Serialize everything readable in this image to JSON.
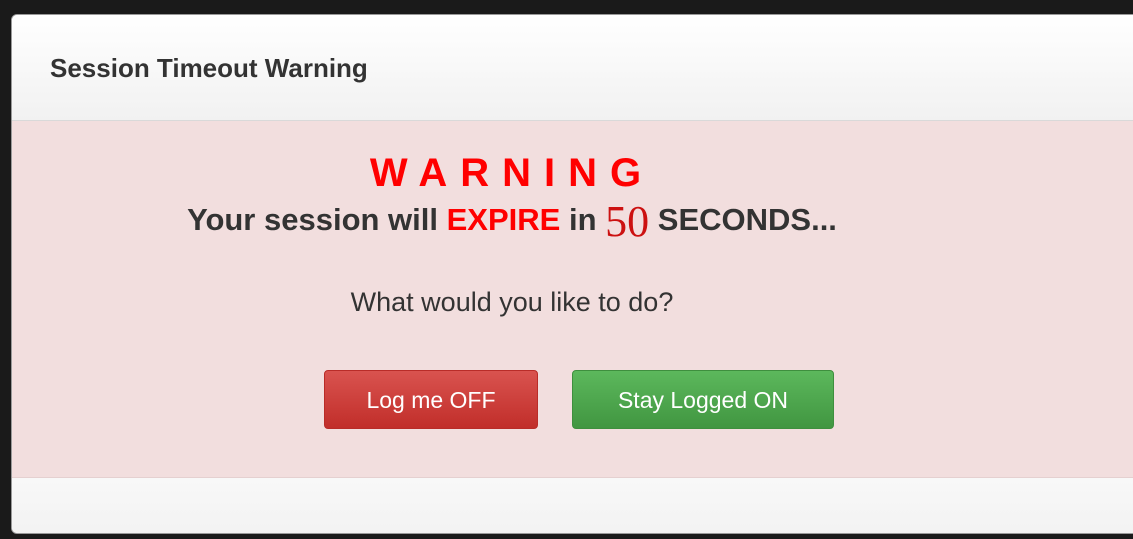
{
  "modal": {
    "title": "Session Timeout Warning",
    "warning_heading": "WARNING",
    "message_prefix": "Your session will",
    "expire_word": "EXPIRE",
    "message_in": "in",
    "countdown_value": "50",
    "message_suffix": "SECONDS...",
    "question": "What would you like to do?",
    "logoff_label": "Log me OFF",
    "stay_label": "Stay Logged ON"
  },
  "colors": {
    "warning_red": "#ff0000",
    "alert_background": "#f2dede",
    "danger_button": "#d9534f",
    "success_button": "#5cb85c"
  }
}
